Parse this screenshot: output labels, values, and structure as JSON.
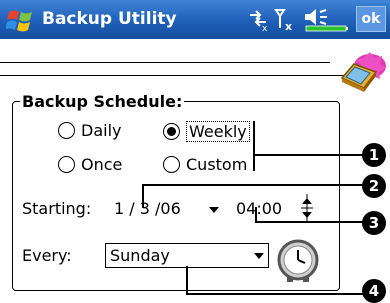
{
  "title_bar": {
    "app_title": "Backup Utility",
    "ok_label": "ok",
    "icons": [
      "start-menu-icon",
      "connectivity-icon",
      "signal-icon",
      "volume-icon",
      "battery-icon"
    ]
  },
  "group": {
    "title": "Backup Schedule:"
  },
  "frequency": {
    "options": [
      {
        "label": "Daily",
        "selected": false
      },
      {
        "label": "Weekly",
        "selected": true
      },
      {
        "label": "Once",
        "selected": false
      },
      {
        "label": "Custom",
        "selected": false
      }
    ]
  },
  "starting": {
    "label": "Starting:",
    "date": "1 / 3 /06",
    "time": "04:00"
  },
  "every": {
    "label": "Every:",
    "value": "Sunday"
  },
  "callouts": [
    "1",
    "2",
    "3",
    "4"
  ],
  "colors": {
    "title_bar": "#1e5fb8",
    "ok_button": "#5b97e0",
    "background": "#ffffff"
  }
}
